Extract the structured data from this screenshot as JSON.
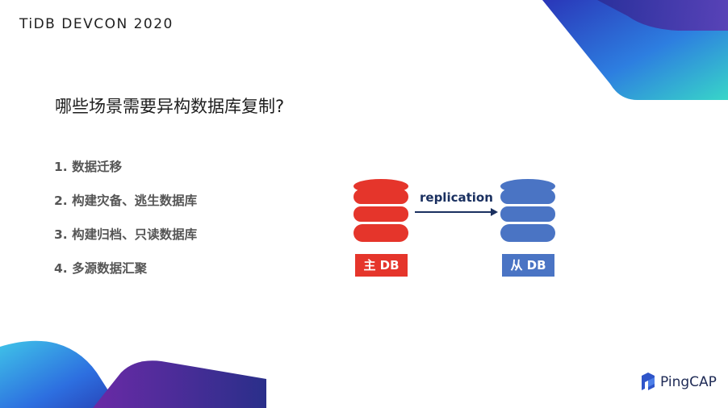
{
  "header": {
    "brand_title": "TiDB DEVCON 2020"
  },
  "heading": "哪些场景需要异构数据库复制?",
  "list_items": [
    "1. 数据迁移",
    "2. 构建灾备、逃生数据库",
    "3. 构建归档、只读数据库",
    "4. 多源数据汇聚"
  ],
  "diagram": {
    "primary_label": "主 DB",
    "secondary_label": "从 DB",
    "arrow_label": "replication",
    "colors": {
      "primary": "#e5352b",
      "secondary": "#4a74c4",
      "arrow": "#1a3060"
    }
  },
  "footer": {
    "logo_text": "PingCAP",
    "logo_icon": "pingcap-logo-icon"
  }
}
